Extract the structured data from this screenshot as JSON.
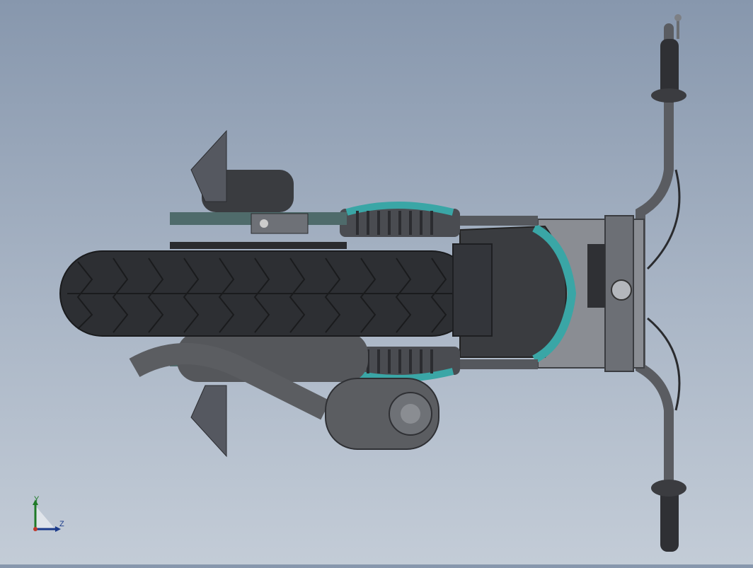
{
  "viewport": {
    "background_top": "#8797ad",
    "background_bottom": "#c3ccd7",
    "model": "motorcycle-top-view"
  },
  "colors": {
    "tire": "#2d2f33",
    "frame_dark": "#4b4d52",
    "frame_mid": "#6b6e74",
    "accent_teal": "#3aa6a6",
    "exhaust": "#5b5d61",
    "grip": "#3a3b3e"
  },
  "triad": {
    "y_label": "Y",
    "z_label": "Z",
    "y_color": "#1f7a28",
    "z_color": "#1b3a8a"
  }
}
